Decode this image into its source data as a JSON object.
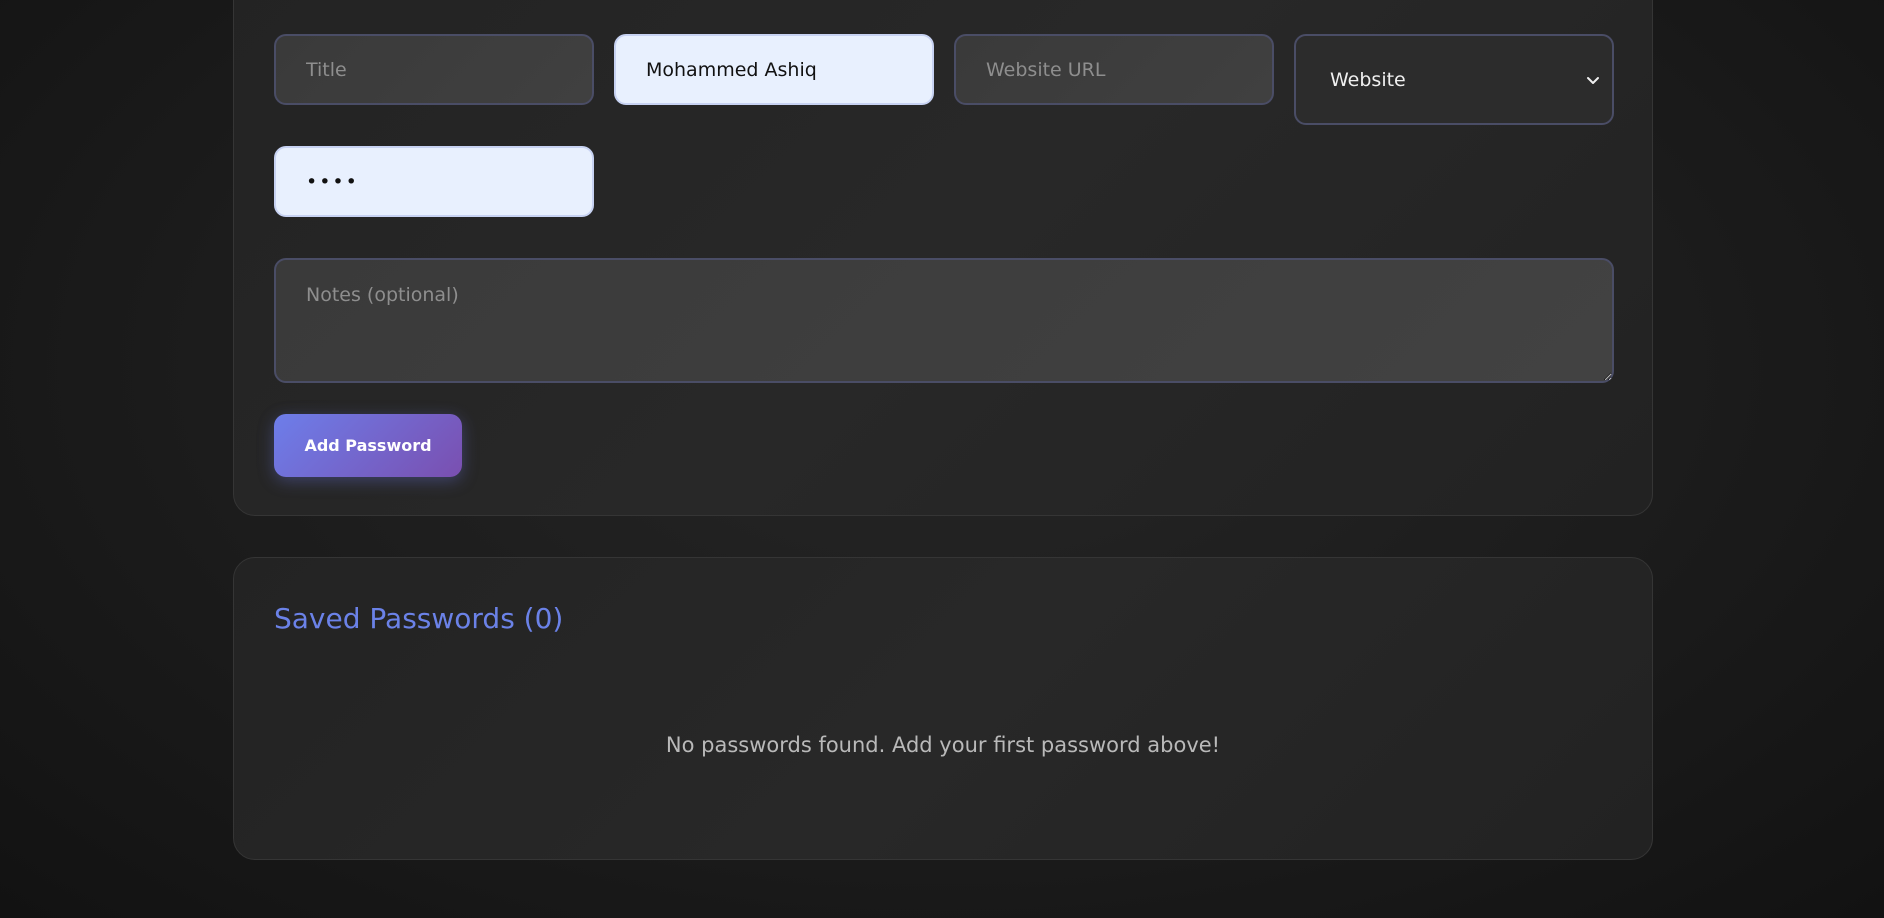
{
  "form": {
    "title_placeholder": "Title",
    "username_value": "Mohammed Ashiq",
    "url_placeholder": "Website URL",
    "category": {
      "selected": "Website",
      "options": [
        "Website"
      ]
    },
    "password_value": "abcd",
    "notes_placeholder": "Notes (optional)",
    "add_button_label": "Add Password"
  },
  "saved": {
    "title": "Saved Passwords (0)",
    "empty_message": "No passwords found. Add your first password above!"
  },
  "colors": {
    "accent": "#667eea",
    "button_gradient_end": "#764ba2",
    "autofill_bg": "#e8f0fe"
  },
  "icons": {
    "select_arrow": "chevron-down-icon"
  }
}
